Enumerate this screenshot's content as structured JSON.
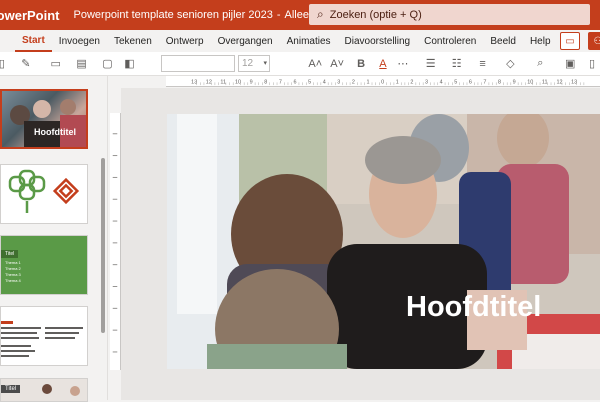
{
  "titlebar": {
    "app_name": "PowerPoint",
    "doc_title": "Powerpoint template senioren pijler 2023",
    "separator": "-",
    "mode": "Alleen-weergeven"
  },
  "search": {
    "placeholder": "Zoeken (optie + Q)"
  },
  "tabs": [
    {
      "label": "Start",
      "active": true
    },
    {
      "label": "Invoegen"
    },
    {
      "label": "Tekenen"
    },
    {
      "label": "Ontwerp"
    },
    {
      "label": "Overgangen"
    },
    {
      "label": "Animaties"
    },
    {
      "label": "Diavoorstelling"
    },
    {
      "label": "Controleren"
    },
    {
      "label": "Beeld"
    },
    {
      "label": "Help"
    }
  ],
  "toolbar": {
    "font_size": "12"
  },
  "thumbnails": [
    {
      "title": "Hoofdtitel"
    },
    {
      "title": ""
    },
    {
      "tag": "Titel",
      "lines": [
        "Thema 1",
        "Thema 2",
        "Thema 3",
        "Thema 4"
      ]
    },
    {
      "title": ""
    },
    {
      "tag": "Titel"
    }
  ],
  "ruler": {
    "hticks": [
      "13",
      "12",
      "11",
      "10",
      "9",
      "8",
      "7",
      "6",
      "5",
      "4",
      "3",
      "2",
      "1",
      "0",
      "1",
      "2",
      "3",
      "4",
      "5",
      "6",
      "7",
      "8",
      "9",
      "10",
      "11",
      "12",
      "13"
    ]
  },
  "slide": {
    "title": "Hoofdtitel"
  },
  "colors": {
    "accent": "#c43e1c",
    "green": "#5a9a47"
  }
}
